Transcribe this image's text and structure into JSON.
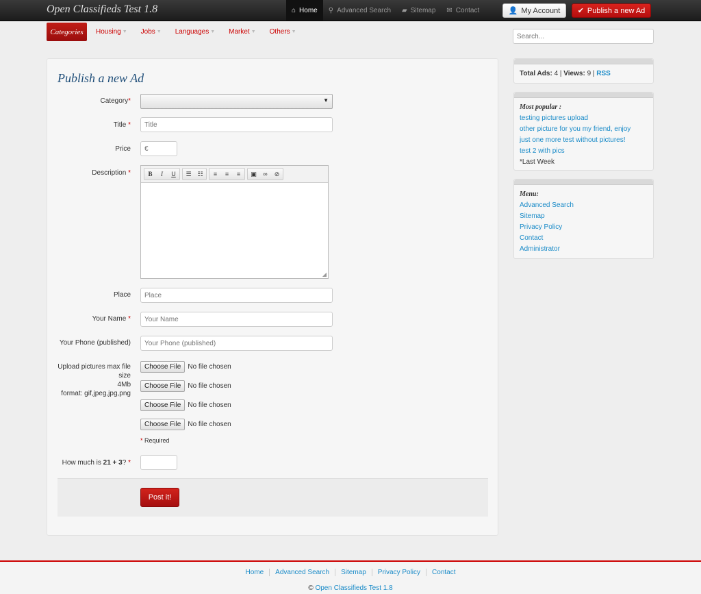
{
  "navbar": {
    "brand": "Open Classifieds Test 1.8",
    "links": [
      {
        "label": "Home",
        "icon": "home-icon",
        "active": true
      },
      {
        "label": "Advanced Search",
        "icon": "search-icon"
      },
      {
        "label": "Sitemap",
        "icon": "folder-icon"
      },
      {
        "label": "Contact",
        "icon": "envelope-icon"
      }
    ],
    "account_label": "My Account",
    "publish_label": "Publish a new Ad"
  },
  "subnav": {
    "categories_label": "Categories",
    "items": [
      "Housing",
      "Jobs",
      "Languages",
      "Market",
      "Others"
    ]
  },
  "search": {
    "placeholder": "Search..."
  },
  "form": {
    "heading": "Publish a new Ad",
    "category_label": "Category",
    "title_label": "Title",
    "title_placeholder": "Title",
    "price_label": "Price",
    "price_placeholder": "€",
    "description_label": "Description",
    "place_label": "Place",
    "place_placeholder": "Place",
    "name_label": "Your Name",
    "name_placeholder": "Your Name",
    "phone_label": "Your Phone (published)",
    "phone_placeholder": "Your Phone (published)",
    "upload_label_1": "Upload pictures max file",
    "upload_label_2": "size",
    "upload_label_3": "4Mb",
    "upload_label_4": "format: gif,jpeg,jpg,png",
    "file_button": "Choose File",
    "file_status": "No file chosen",
    "required_note": "Required",
    "captcha_prefix": "How much is ",
    "captcha_expr": "21 + 3",
    "captcha_suffix": "?",
    "submit_label": "Post it!",
    "required_mark": "*"
  },
  "sidebar": {
    "stats": {
      "total_label": "Total Ads:",
      "total_value": "4",
      "views_label": "Views:",
      "views_value": "9",
      "rss": "RSS"
    },
    "popular": {
      "title": "Most popular :",
      "items": [
        "testing pictures upload",
        "other picture for you my friend, enjoy",
        "just one more test without pictures!",
        "test 2 with pics"
      ],
      "note": "*Last Week"
    },
    "menu": {
      "title": "Menu:",
      "items": [
        "Advanced Search",
        "Sitemap",
        "Privacy Policy",
        "Contact",
        "Administrator"
      ]
    }
  },
  "footer": {
    "links": [
      "Home",
      "Advanced Search",
      "Sitemap",
      "Privacy Policy",
      "Contact"
    ],
    "copyright_symbol": "©",
    "copyright_link": "Open Classifieds Test 1.8"
  }
}
